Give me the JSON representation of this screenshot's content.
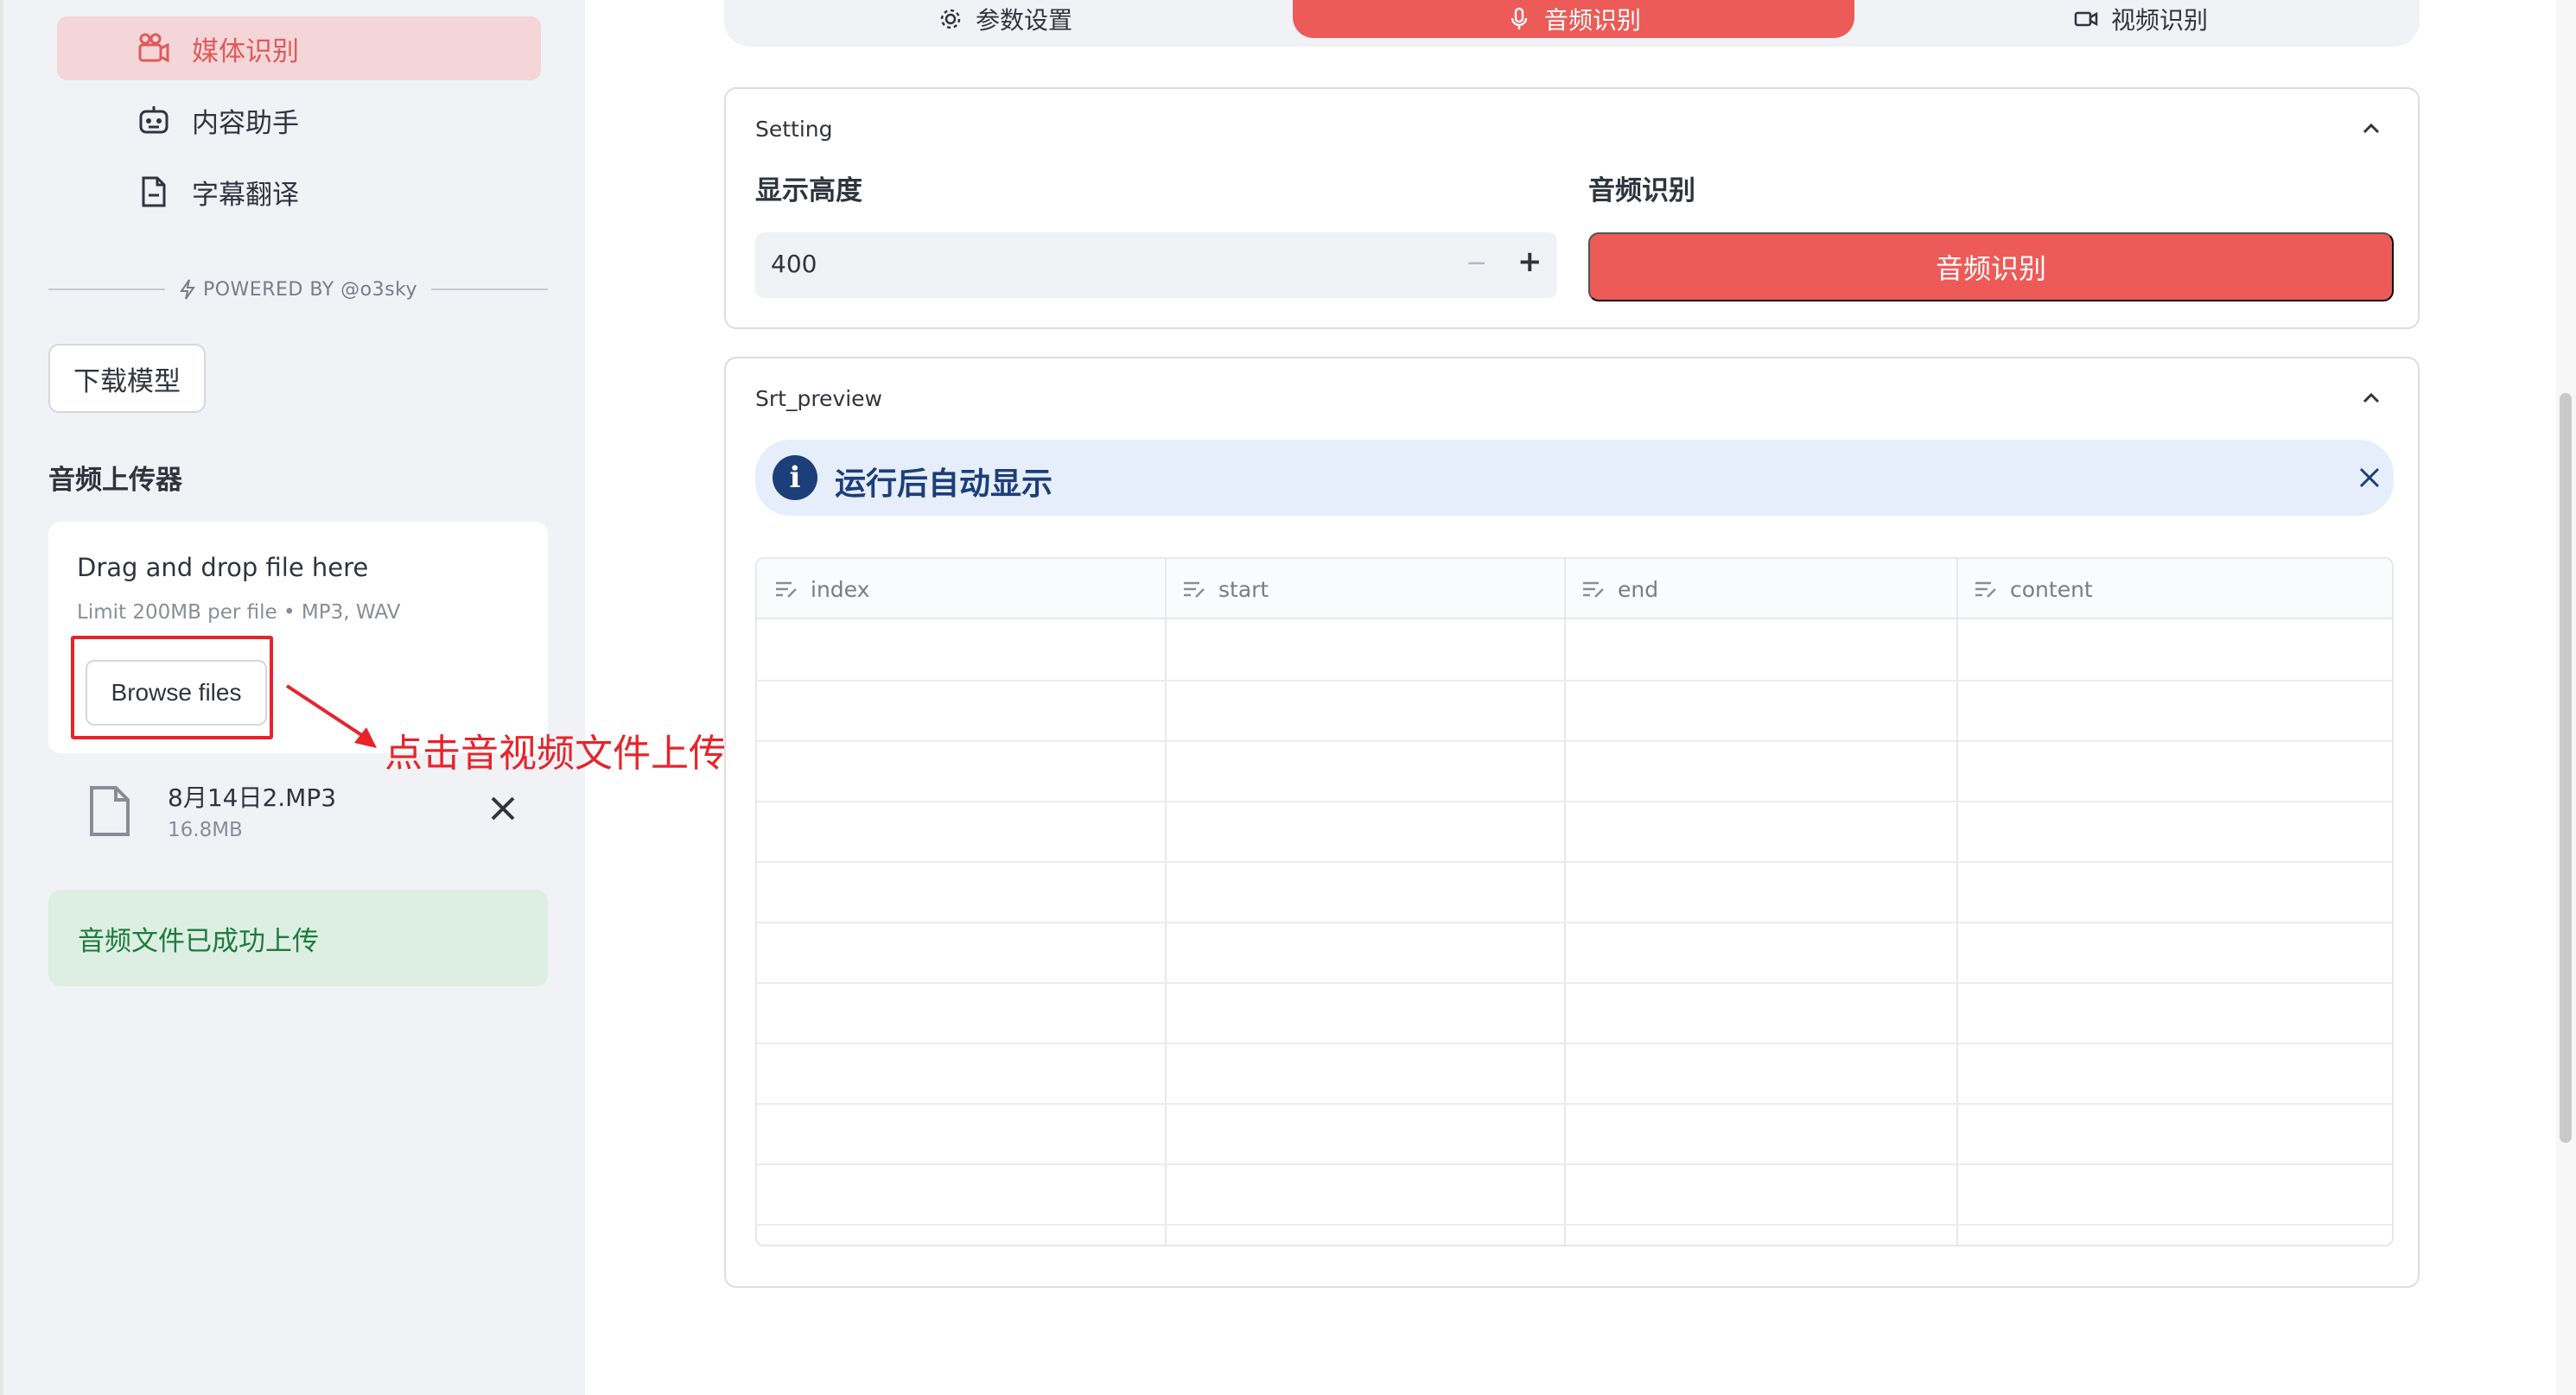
{
  "sidebar": {
    "nav": [
      {
        "label": "媒体识别",
        "icon": "media-icon",
        "active": true
      },
      {
        "label": "内容助手",
        "icon": "robot-icon",
        "active": false
      },
      {
        "label": "字幕翻译",
        "icon": "document-icon",
        "active": false
      }
    ],
    "powered_by": "POWERED BY @o3sky",
    "download_button": "下载模型",
    "uploader_title": "音频上传器",
    "dropzone": {
      "main_text": "Drag and drop file here",
      "sub_text": "Limit 200MB per file • MP3, WAV",
      "browse_label": "Browse files"
    },
    "file": {
      "name": "8月14日2.MP3",
      "size": "16.8MB"
    },
    "success_message": "音频文件已成功上传"
  },
  "annotation": {
    "text": "点击音视频文件上传",
    "color": "#e8232a"
  },
  "tabs": [
    {
      "label": "参数设置",
      "icon": "gear-icon",
      "active": false
    },
    {
      "label": "音频识别",
      "icon": "microphone-icon",
      "active": true
    },
    {
      "label": "视频识别",
      "icon": "video-icon",
      "active": false
    }
  ],
  "setting_card": {
    "title": "Setting",
    "height_label": "显示高度",
    "height_value": "400",
    "recognize_label": "音频识别",
    "recognize_button": "音频识别"
  },
  "preview_card": {
    "title": "Srt_preview",
    "info_text": "运行后自动显示",
    "columns": [
      "index",
      "start",
      "end",
      "content"
    ]
  },
  "colors": {
    "accent": "#ec5b57",
    "sidebar_bg": "#f0f2f6",
    "success_bg": "#dcefe2",
    "info_bg": "#e6eefb"
  }
}
